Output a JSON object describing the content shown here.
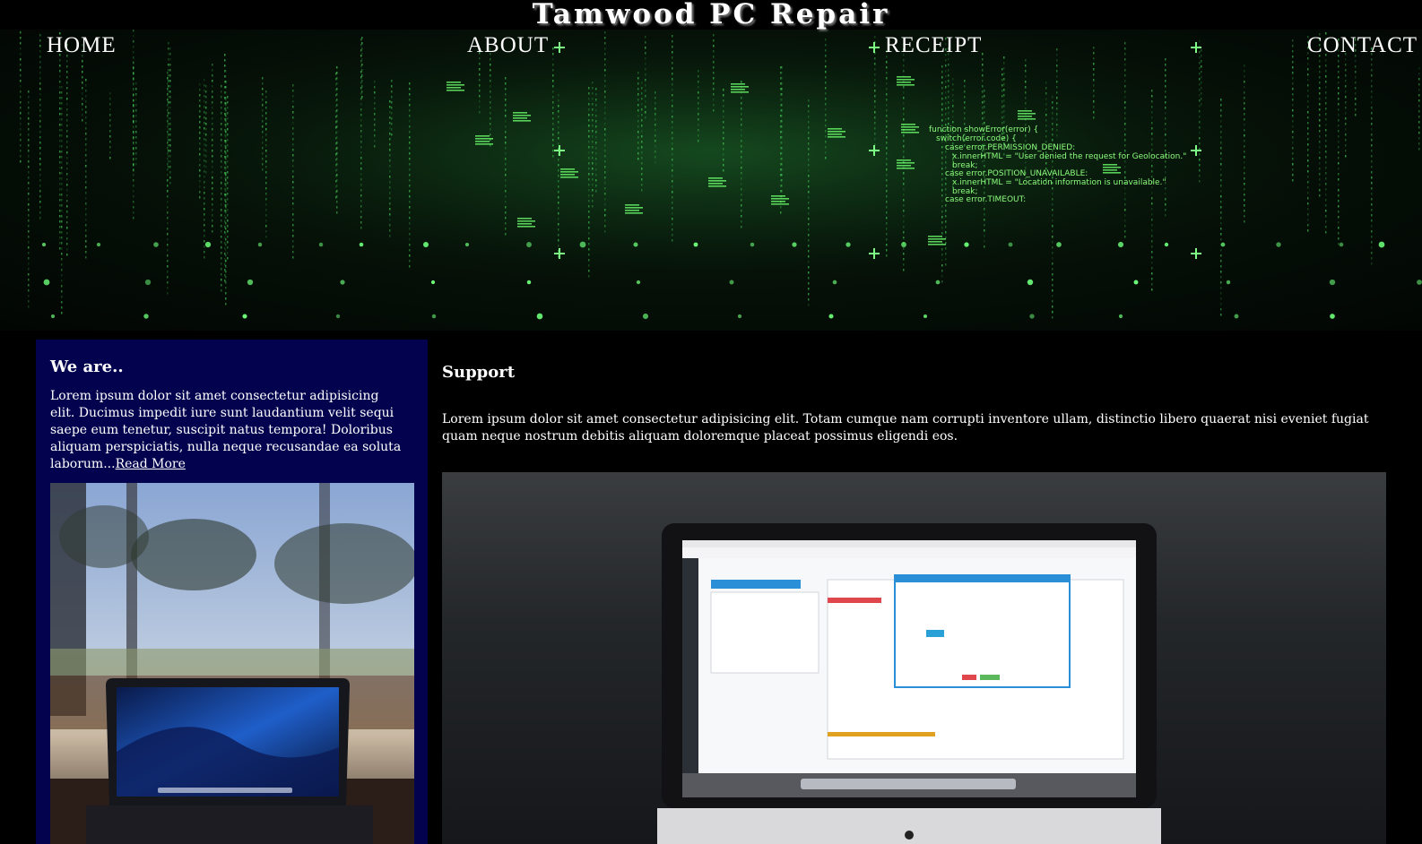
{
  "site": {
    "title": "Tamwood PC Repair"
  },
  "nav": {
    "home": "HOME",
    "about": "ABOUT",
    "receipt": "RECEIPT",
    "contact": "CONTACT"
  },
  "hero": {
    "code_lines": [
      "function showError(error) {",
      "switch(error.code) {",
      "case error.PERMISSION_DENIED:",
      "x.innerHTML = \"User denied the request for Geolocation.\"",
      "break;",
      "case error.POSITION_UNAVAILABLE:",
      "x.innerHTML = \"Location information is unavailable.\"",
      "break;",
      "case error.TIMEOUT:"
    ]
  },
  "left": {
    "heading": "We are..",
    "body": "Lorem ipsum dolor sit amet consectetur adipisicing elit. Ducimus impedit iure sunt laudantium velit sequi saepe eum tenetur, suscipit natus tempora! Doloribus aliquam perspiciatis, nulla neque recusandae ea soluta laborum...",
    "read_more": "Read More"
  },
  "main": {
    "heading": "Support",
    "body": "Lorem ipsum dolor sit amet consectetur adipisicing elit. Totam cumque nam corrupti inventore ullam, distinctio libero quaerat nisi eveniet fugiat quam neque nostrum debitis aliquam doloremque placeat possimus eligendi eos."
  },
  "colors": {
    "hero_green": "#5dff6a",
    "panel_navy": "#02024f",
    "background": "#000000"
  }
}
